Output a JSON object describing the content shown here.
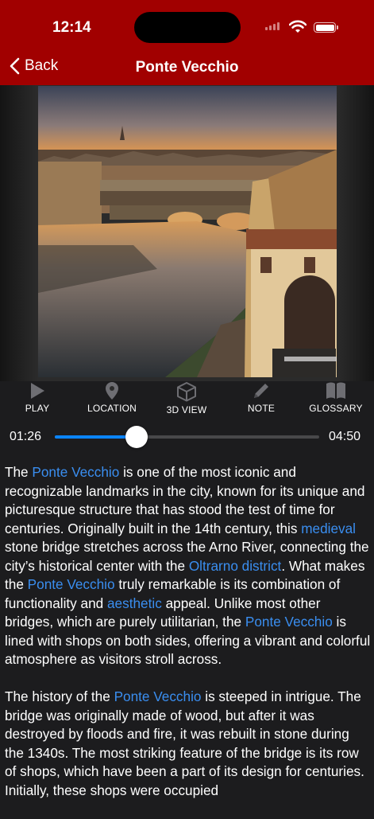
{
  "status_bar": {
    "time": "12:14"
  },
  "nav": {
    "back_label": "Back",
    "title": "Ponte Vecchio"
  },
  "toolbar": {
    "items": [
      {
        "label": "PLAY",
        "icon": "play-icon"
      },
      {
        "label": "LOCATION",
        "icon": "location-pin-icon"
      },
      {
        "label": "3D VIEW",
        "icon": "cube-icon"
      },
      {
        "label": "NOTE",
        "icon": "pencil-icon"
      },
      {
        "label": "GLOSSARY",
        "icon": "book-icon"
      }
    ]
  },
  "player": {
    "current": "01:26",
    "total": "04:50",
    "progress": 0.31
  },
  "article": {
    "paragraphs": [
      [
        {
          "t": "The "
        },
        {
          "t": "Ponte Vecchio",
          "link": true
        },
        {
          "t": " is one of the most iconic and recognizable landmarks in the city, known for its unique and picturesque structure that has stood the test of time for centuries. Originally built in the 14th century, this "
        },
        {
          "t": "medieval",
          "link": true
        },
        {
          "t": " stone bridge stretches across the Arno River, connecting the city’s historical center with the "
        },
        {
          "t": "Oltrarno district",
          "link": true
        },
        {
          "t": ". What makes the "
        },
        {
          "t": "Ponte Vecchio",
          "link": true
        },
        {
          "t": " truly remarkable is its combination of functionality and "
        },
        {
          "t": "aesthetic",
          "link": true
        },
        {
          "t": " appeal. Unlike most other bridges, which are purely utilitarian, the "
        },
        {
          "t": "Ponte Vecchio",
          "link": true
        },
        {
          "t": " is lined with shops on both sides, offering a vibrant and colorful atmosphere as visitors stroll across."
        }
      ],
      [
        {
          "t": "The history of the "
        },
        {
          "t": "Ponte Vecchio",
          "link": true
        },
        {
          "t": " is steeped in intrigue. The bridge was originally made of wood, but after it was destroyed by floods and fire, it was rebuilt in stone during the 1340s. The most striking feature of the bridge is its row of shops, which have been a part of its design for centuries. Initially, these shops were occupied"
        }
      ]
    ]
  },
  "colors": {
    "header": "#a10000",
    "background": "#1c1c1e",
    "accent": "#0a84ff",
    "link": "#3a8ef0"
  }
}
